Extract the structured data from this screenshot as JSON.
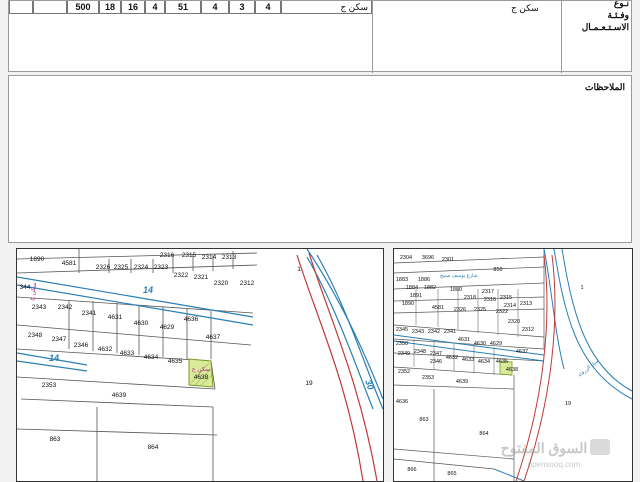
{
  "form": {
    "cells": [
      "500",
      "18",
      "16",
      "4",
      "51",
      "4",
      "3",
      "4"
    ],
    "cell_partial": "سكن ج",
    "usage_value": "سكن ج",
    "usage_label_lines": [
      "نـوع",
      "وفـئـة",
      "الاسـتـعـمـال"
    ]
  },
  "notes": {
    "label": "الملاحظات"
  },
  "map_left": {
    "parcels": [
      "1890",
      "4581",
      "2326",
      "2325",
      "2324",
      "2323",
      "2322",
      "2321",
      "2320",
      "2316",
      "2315",
      "2314",
      "2313",
      "2312",
      "344",
      "2343",
      "2342",
      "2341",
      "4631",
      "4630",
      "4629",
      "4636",
      "4637",
      "2348",
      "2347",
      "2346",
      "4632",
      "4633",
      "4634",
      "4635",
      "4638",
      "2353",
      "4639",
      "863",
      "864",
      "19",
      "1"
    ],
    "street_labels": [
      "14",
      "14",
      "30"
    ],
    "highlight_label": "سكن ج"
  },
  "map_right": {
    "parcels": [
      "2304",
      "3696",
      "2301",
      "850",
      "1883",
      "1886",
      "1884",
      "1882",
      "1880",
      "2317",
      "2318",
      "2316",
      "2315",
      "2314",
      "2313",
      "1891",
      "1890",
      "4581",
      "2326",
      "2325",
      "2322",
      "2320",
      "2312",
      "2345",
      "2343",
      "2342",
      "2341",
      "4631",
      "4630",
      "4629",
      "4637",
      "2350",
      "2349",
      "2348",
      "2347",
      "2346",
      "4632",
      "4633",
      "4634",
      "4635",
      "4638",
      "2352",
      "2353",
      "4639",
      "4636",
      "863",
      "864",
      "866",
      "865",
      "19",
      "1"
    ],
    "street_label": "شارع يوسف صبيح",
    "river_label": "سيل الزرقاء",
    "watermark_ar": "السوق المفتوح",
    "watermark_en": "opensooq.com"
  }
}
